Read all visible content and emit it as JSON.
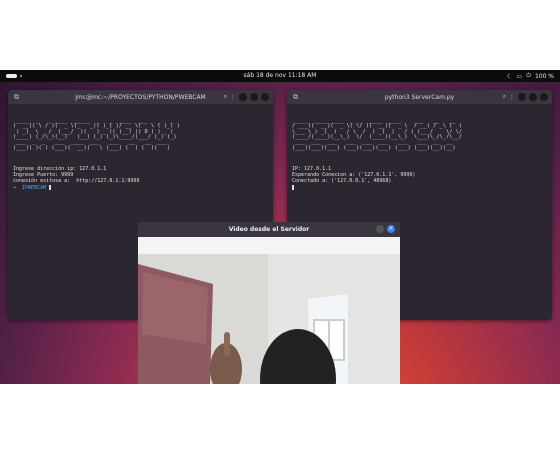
{
  "topbar": {
    "clock": "sáb 18 de nov  11:18 AM",
    "battery": "100 %"
  },
  "left_terminal": {
    "title": "jmc@mc:~/PROYECTOS/PYTHON/PWEBCAM",
    "banner": [
      " ____  _   _ ____  _____  _   _  ____  ___   _   _ ",
      "(  __)( \\ / )(  _ \\(_   _)( )_( )/ __ \\(   \\ ( )_( )",
      " ) _)  \\   /  )___/  )(   ) _ (( (__) )) D ( ) _ ( ",
      "(____) (_/\\_)(__)   (__) (_) (_)\\____/(___/ (_) (_)",
      " ___  _  _   ___  ____  ___   ___   __   __  ___  ",
      "(___)( )( ) (___)(  __)(   \\ (___) (  ) (  )(   ) "
    ],
    "lines": [
      "Ingrese dirección ip: 127.0.1.1",
      "Ingrese Puerto: 9999",
      "conexión exitosa a:  http://127.0.1.1:9999"
    ],
    "prompt": "➜  IPWEBCAM"
  },
  "right_terminal": {
    "title": "python3 ServerCam.py",
    "banner": [
      " ____  ____ ____  _  _  ____  ____    ___   __   __ ",
      "/ ___)(  __)(  _ \\( \\/ )(  __)(  _ \\  / __) / _\\ (  )",
      "\\___ \\ ) _)  )   / \\  /  ) _)  )   / ( (__ /    \\/ \\/",
      "(____/(____)(__\\_)  \\/  (____)(__\\_)  \\___)\\_/\\_/\\__/",
      " ___  ___  ___   ___  ___  ___   ___   ___  __  __ ",
      "(___)(___)(___) (___)(___)(___) (___) (___)(__)(__)"
    ],
    "lines": [
      "IP: 127.0.1.1",
      "Esperando Conexion a: ('127.0.1.1', 9999)",
      "Conectado a: ('127.0.0.1', 48968)"
    ]
  },
  "video_window": {
    "title": "Video desde el Servidor"
  },
  "colors": {
    "prompt": "#4aa3ff",
    "accent_close": "#3b82f6"
  }
}
